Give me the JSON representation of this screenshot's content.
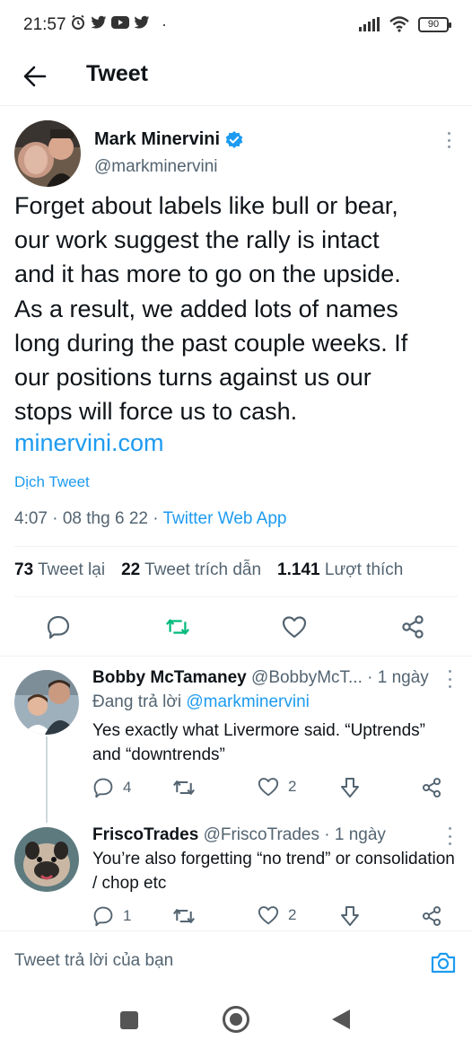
{
  "status_bar": {
    "time": "21:57",
    "battery": "90",
    "dot": "·"
  },
  "header": {
    "title": "Tweet"
  },
  "tweet": {
    "author_name": "Mark Minervini",
    "author_handle": "@markminervini",
    "verified": true,
    "lines": [
      "Forget about labels like bull or bear,",
      "our work suggest the rally is intact",
      "and it has more to go on the upside.",
      "As a result, we added lots of names",
      "long during the past couple weeks. If",
      "our positions turns against us our",
      "stops will force us to cash."
    ],
    "link": "minervini.com",
    "translate": "Dịch Tweet",
    "timestamp": "4:07 · 08 thg 6 22 · ",
    "app": "Twitter Web App",
    "stats": {
      "retweets": "73",
      "retweets_label": "Tweet lại",
      "quotes": "22",
      "quotes_label": "Tweet trích dẫn",
      "likes": "1.141",
      "likes_label": "Lượt thích"
    }
  },
  "replies": [
    {
      "name": "Bobby McTamaney",
      "handle": "@BobbyMcT...",
      "time": " · 1 ngày",
      "replying_prefix": "Đang trả lời ",
      "replying_mention": "@markminervini",
      "text": "Yes exactly what Livermore said. “Uptrends” and “downtrends”",
      "reply_count": "4",
      "retweet_count": "",
      "like_count": "2"
    },
    {
      "name": "FriscoTrades",
      "handle": "@FriscoTrades",
      "time": " · 1 ngày",
      "text": "You’re also forgetting “no trend” or consolidation / chop etc",
      "reply_count": "1",
      "retweet_count": "",
      "like_count": "2"
    }
  ],
  "compose": {
    "placeholder": "Tweet trả lời của bạn"
  },
  "colors": {
    "accent": "#1d9bf0",
    "retweet_green": "#00ba7c",
    "secondary_text": "#536471"
  }
}
